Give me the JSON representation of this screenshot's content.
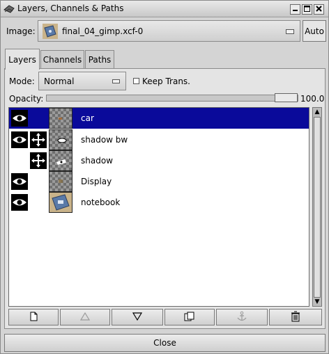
{
  "window": {
    "title": "Layers, Channels & Paths",
    "controls": [
      "minimize-icon",
      "maximize-icon",
      "close-icon"
    ]
  },
  "image_selector": {
    "label": "Image:",
    "value": "final_04_gimp.xcf-0",
    "auto_label": "Auto"
  },
  "tabs": [
    {
      "label": "Layers",
      "active": true
    },
    {
      "label": "Channels",
      "active": false
    },
    {
      "label": "Paths",
      "active": false
    }
  ],
  "mode": {
    "label": "Mode:",
    "value": "Normal",
    "keep_trans_label": "Keep Trans.",
    "keep_trans_checked": false
  },
  "opacity": {
    "label": "Opacity:",
    "value": "100.0",
    "fraction": 1.0
  },
  "layers": [
    {
      "name": "car",
      "visible": true,
      "linked": false,
      "selected": true,
      "thumb": "car"
    },
    {
      "name": "shadow bw",
      "visible": true,
      "linked": true,
      "selected": false,
      "thumb": "shadow-bw"
    },
    {
      "name": "shadow",
      "visible": false,
      "linked": true,
      "selected": false,
      "thumb": "shadow"
    },
    {
      "name": "Display",
      "visible": true,
      "linked": false,
      "selected": false,
      "thumb": "display"
    },
    {
      "name": "notebook",
      "visible": true,
      "linked": false,
      "selected": false,
      "thumb": "notebook"
    }
  ],
  "toolbar": {
    "buttons": [
      {
        "icon": "new-layer-icon",
        "enabled": true
      },
      {
        "icon": "raise-layer-icon",
        "enabled": false
      },
      {
        "icon": "lower-layer-icon",
        "enabled": true
      },
      {
        "icon": "duplicate-layer-icon",
        "enabled": true
      },
      {
        "icon": "anchor-layer-icon",
        "enabled": false
      },
      {
        "icon": "delete-layer-icon",
        "enabled": true
      }
    ]
  },
  "close_label": "Close",
  "colors": {
    "selection": "#0a0a9a",
    "window_bg": "#d4d4d4"
  }
}
